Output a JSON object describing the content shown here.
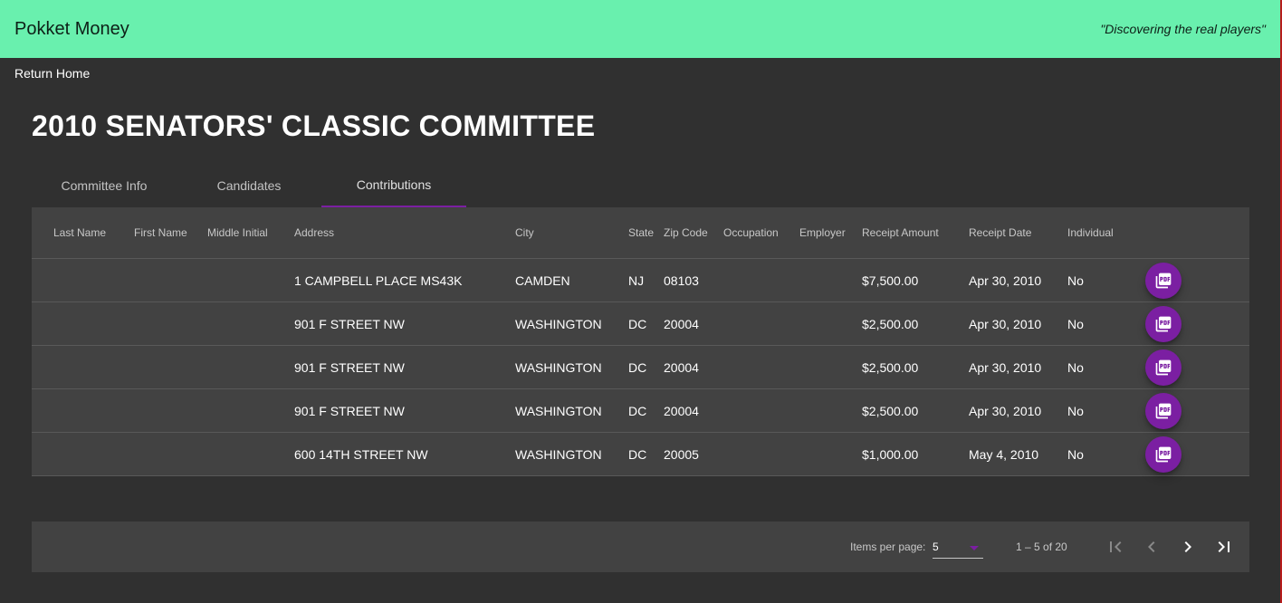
{
  "header": {
    "app_title": "Pokket Money",
    "tagline": "\"Discovering the real players\""
  },
  "nav": {
    "return_home": "Return Home"
  },
  "page": {
    "title": "2010 SENATORS' CLASSIC COMMITTEE"
  },
  "tabs": [
    {
      "label": "Committee Info",
      "active": false
    },
    {
      "label": "Candidates",
      "active": false
    },
    {
      "label": "Contributions",
      "active": true
    }
  ],
  "table": {
    "columns": [
      "Last Name",
      "First Name",
      "Middle Initial",
      "Address",
      "City",
      "State",
      "Zip Code",
      "Occupation",
      "Employer",
      "Receipt Amount",
      "Receipt Date",
      "Individual",
      ""
    ],
    "rows": [
      {
        "last_name": "",
        "first_name": "",
        "middle_initial": "",
        "address": "1 CAMPBELL PLACE MS43K",
        "city": "CAMDEN",
        "state": "NJ",
        "zip": "08103",
        "occupation": "",
        "employer": "",
        "amount": "$7,500.00",
        "date": "Apr 30, 2010",
        "individual": "No",
        "action_icon": "pdf-icon"
      },
      {
        "last_name": "",
        "first_name": "",
        "middle_initial": "",
        "address": "901 F STREET NW",
        "city": "WASHINGTON",
        "state": "DC",
        "zip": "20004",
        "occupation": "",
        "employer": "",
        "amount": "$2,500.00",
        "date": "Apr 30, 2010",
        "individual": "No",
        "action_icon": "pdf-icon"
      },
      {
        "last_name": "",
        "first_name": "",
        "middle_initial": "",
        "address": "901 F STREET NW",
        "city": "WASHINGTON",
        "state": "DC",
        "zip": "20004",
        "occupation": "",
        "employer": "",
        "amount": "$2,500.00",
        "date": "Apr 30, 2010",
        "individual": "No",
        "action_icon": "pdf-icon"
      },
      {
        "last_name": "",
        "first_name": "",
        "middle_initial": "",
        "address": "901 F STREET NW",
        "city": "WASHINGTON",
        "state": "DC",
        "zip": "20004",
        "occupation": "",
        "employer": "",
        "amount": "$2,500.00",
        "date": "Apr 30, 2010",
        "individual": "No",
        "action_icon": "pdf-icon"
      },
      {
        "last_name": "",
        "first_name": "",
        "middle_initial": "",
        "address": "600 14TH STREET NW",
        "city": "WASHINGTON",
        "state": "DC",
        "zip": "20005",
        "occupation": "",
        "employer": "",
        "amount": "$1,000.00",
        "date": "May 4, 2010",
        "individual": "No",
        "action_icon": "pdf-icon"
      }
    ]
  },
  "paginator": {
    "items_per_page_label": "Items per page:",
    "items_per_page_value": "5",
    "range_label": "1 – 5 of 20",
    "icons": [
      "first-page-icon",
      "previous-page-icon",
      "next-page-icon",
      "last-page-icon"
    ]
  },
  "colors": {
    "toolbar": "#69f0ae",
    "accent": "#7b1fa2",
    "background": "#303030",
    "card": "#424242"
  }
}
